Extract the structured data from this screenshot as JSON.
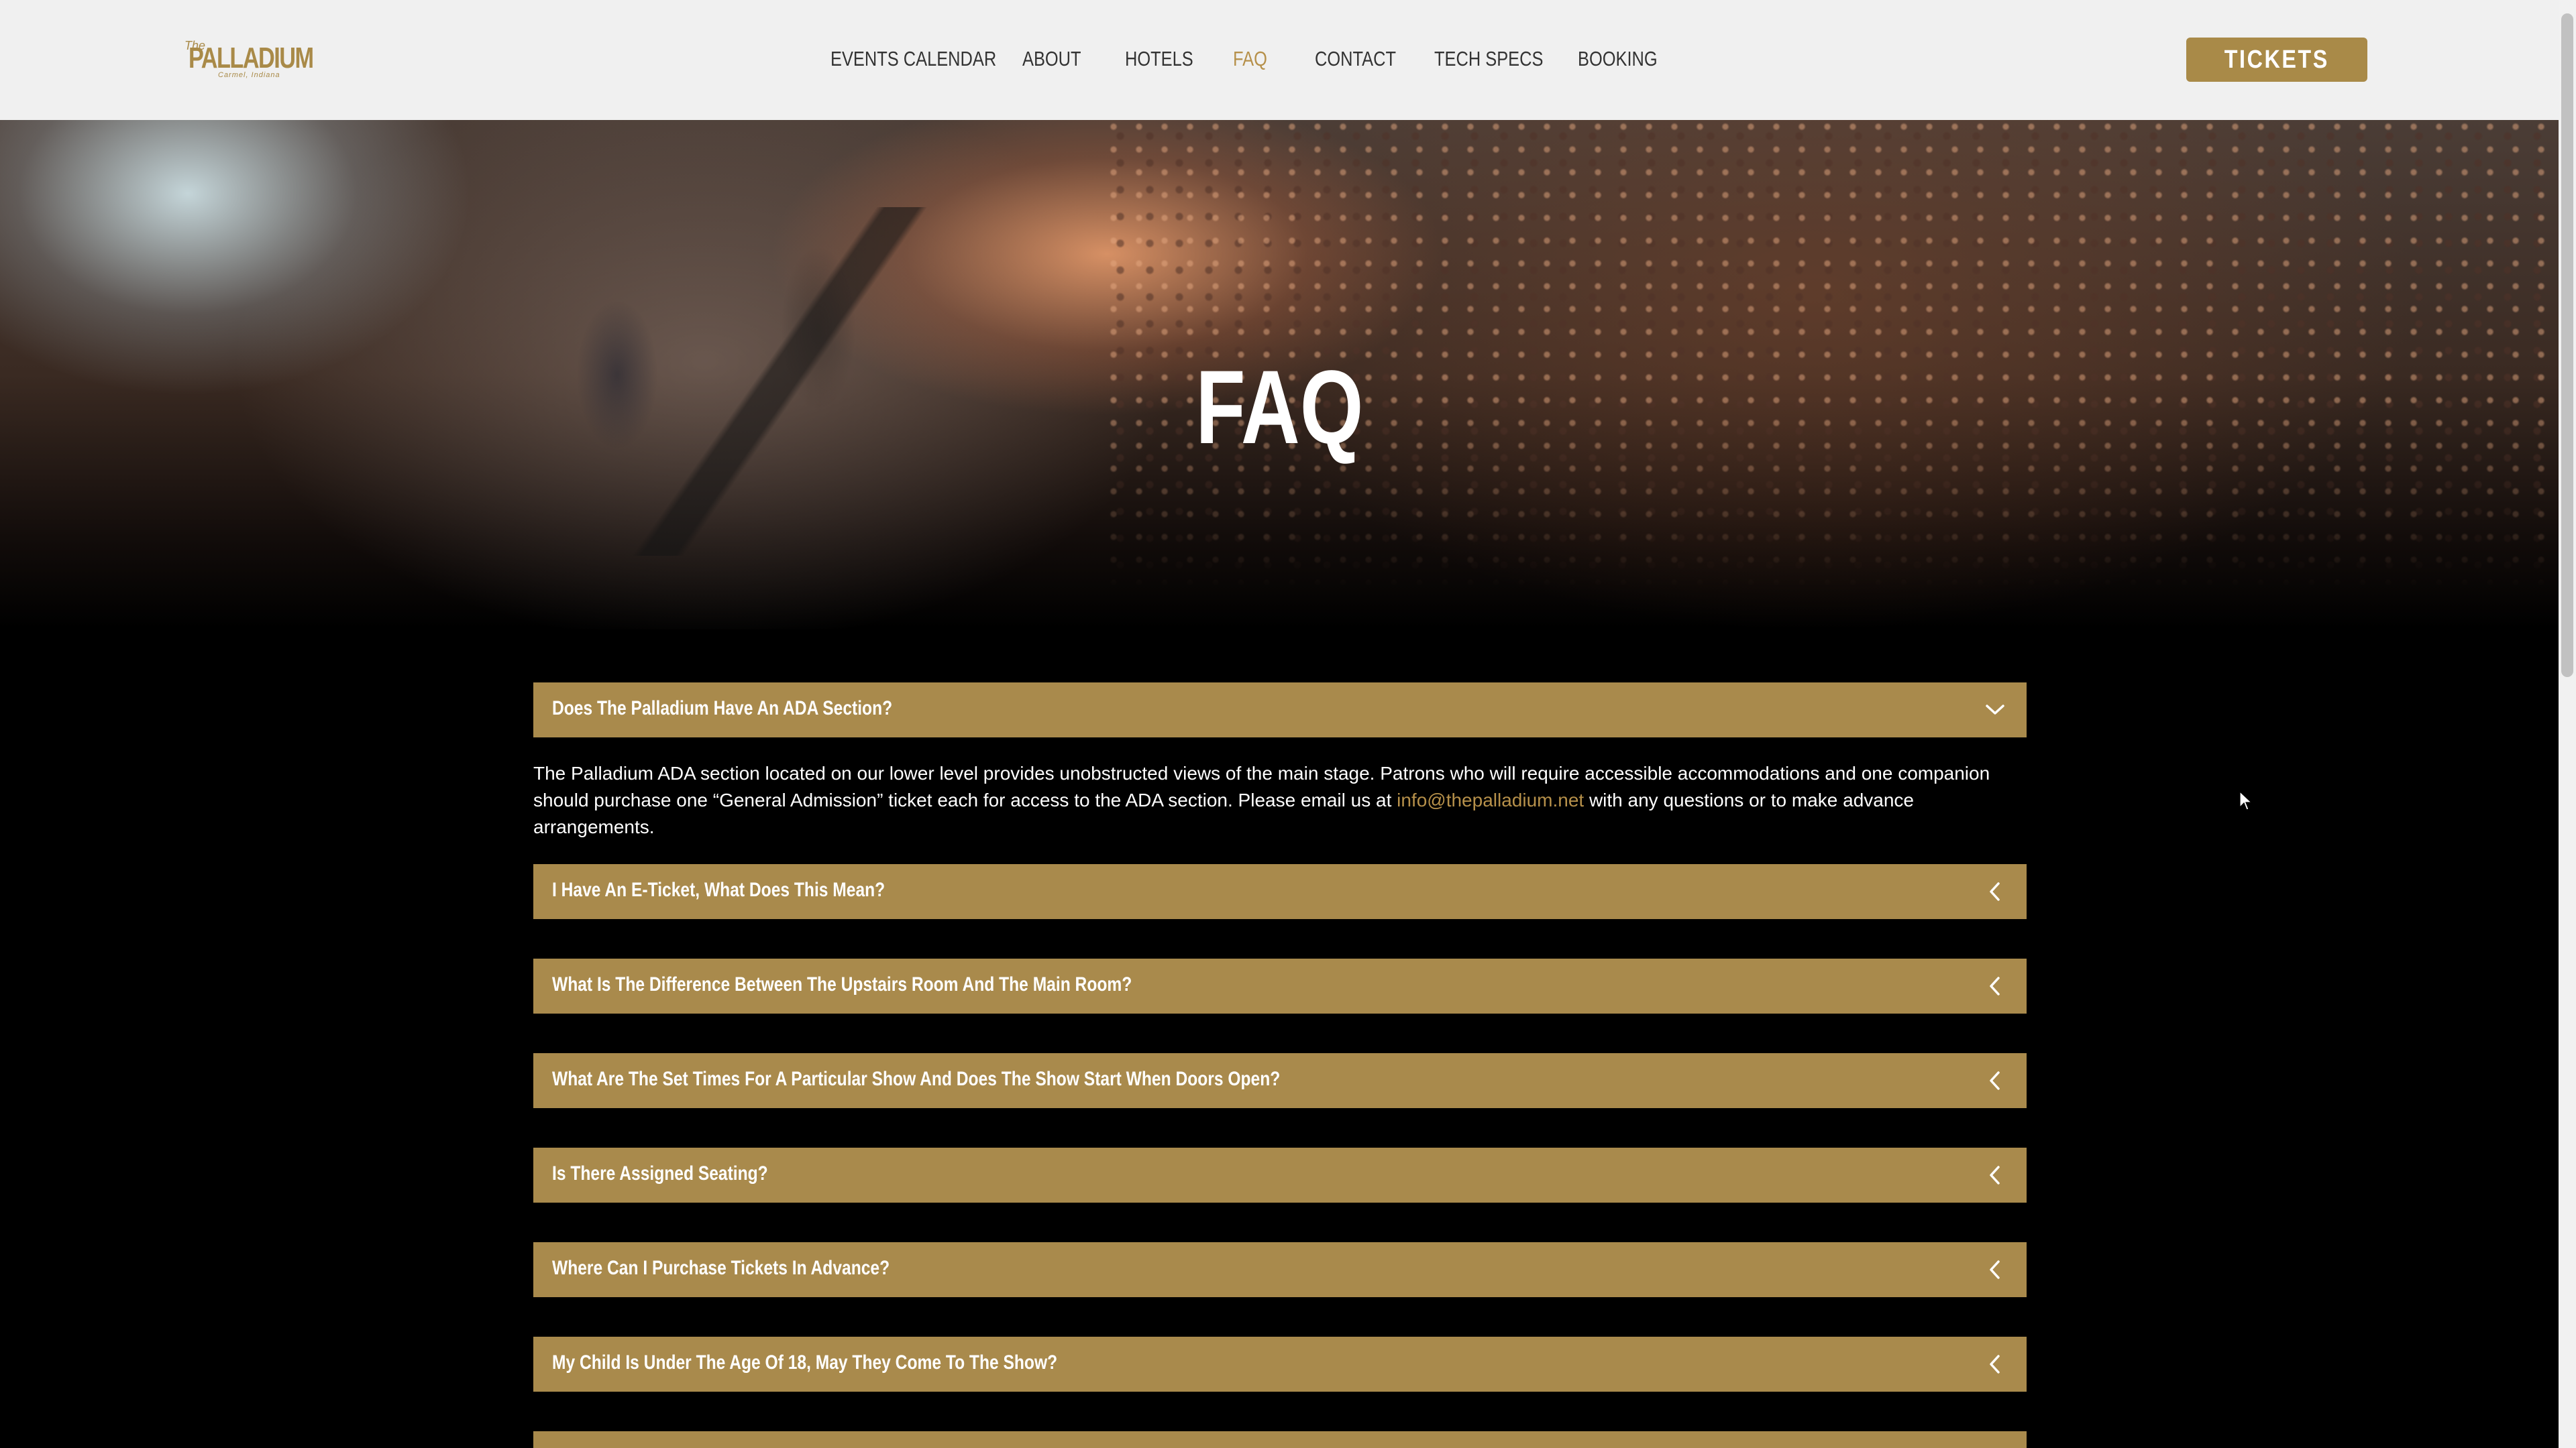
{
  "header": {
    "logo": {
      "the": "The",
      "name": "PALLADIUM",
      "sub": "Carmel, Indiana"
    },
    "nav": [
      {
        "label": "EVENTS CALENDAR",
        "active": false
      },
      {
        "label": "ABOUT",
        "active": false
      },
      {
        "label": "HOTELS",
        "active": false
      },
      {
        "label": "FAQ",
        "active": true
      },
      {
        "label": "CONTACT",
        "active": false
      },
      {
        "label": "TECH SPECS",
        "active": false
      },
      {
        "label": "BOOKING",
        "active": false
      }
    ],
    "tickets_label": "TICKETS"
  },
  "hero": {
    "title": "FAQ"
  },
  "faq": {
    "items": [
      {
        "question": "Does The Palladium Have An ADA Section?",
        "expanded": true,
        "answer_before_link": "The Palladium ADA section located on our lower level provides unobstructed views of the main stage. Patrons who will require accessible accommodations and one companion should purchase one “General Admission” ticket each for access to the ADA section. Please email us at ",
        "answer_link": "info@thepalladium.net",
        "answer_after_link": " with any questions or to make advance arrangements."
      },
      {
        "question": "I Have An E-Ticket, What Does This Mean?",
        "expanded": false
      },
      {
        "question": "What Is The Difference Between The Upstairs Room And The Main Room?",
        "expanded": false
      },
      {
        "question": "What Are The Set Times For A Particular Show And Does The Show Start When Doors Open?",
        "expanded": false
      },
      {
        "question": "Is There Assigned Seating?",
        "expanded": false
      },
      {
        "question": "Where Can I Purchase Tickets In Advance?",
        "expanded": false
      },
      {
        "question": "My Child Is Under The Age Of 18, May They Come To The Show?",
        "expanded": false
      },
      {
        "question": "",
        "expanded": false
      }
    ]
  },
  "colors": {
    "accent": "#a98a4c",
    "active_nav": "#b6904a",
    "header_bg": "#f0f0f0",
    "page_bg": "#000000"
  },
  "icons": {
    "collapsed": "chevron-left-icon",
    "expanded": "chevron-down-icon"
  }
}
